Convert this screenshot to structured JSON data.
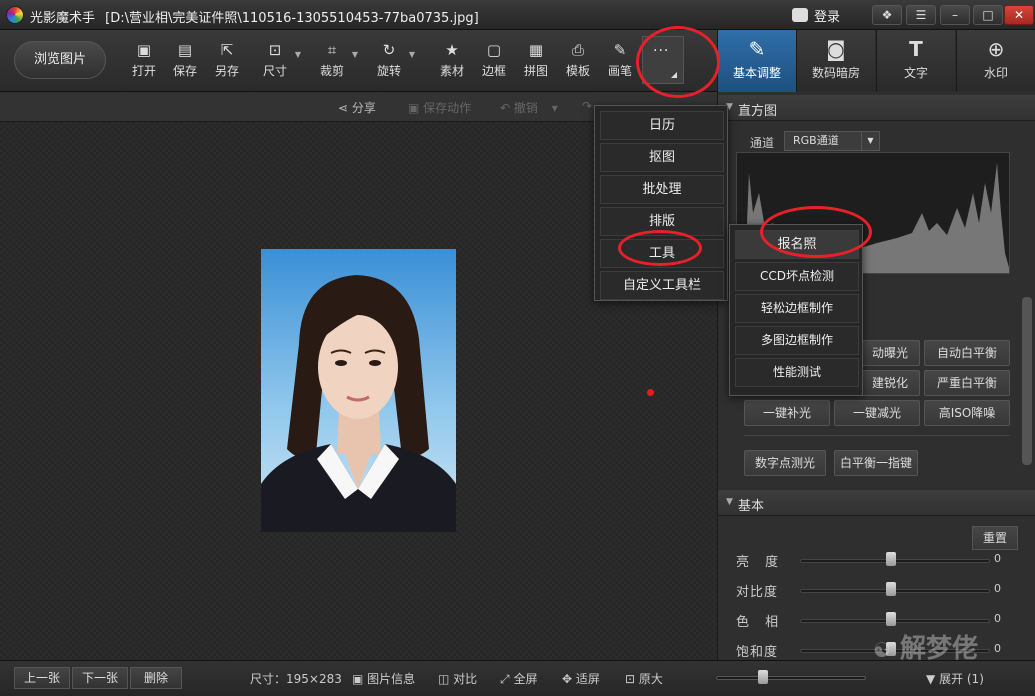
{
  "window": {
    "app_name": "光影魔术手",
    "file_path": "[D:\\营业相\\完美证件照\\110516-1305510453-77ba0735.jpg]",
    "login_label": "登录"
  },
  "toolbar": {
    "browse_label": "浏览图片",
    "tools": [
      {
        "label": "打开",
        "icon": "open-image-icon"
      },
      {
        "label": "保存",
        "icon": "save-icon"
      },
      {
        "label": "另存",
        "icon": "save-as-icon"
      },
      {
        "label": "尺寸",
        "icon": "resize-icon"
      },
      {
        "label": "裁剪",
        "icon": "crop-icon"
      },
      {
        "label": "旋转",
        "icon": "rotate-icon"
      },
      {
        "label": "素材",
        "icon": "material-icon"
      },
      {
        "label": "边框",
        "icon": "frame-icon"
      },
      {
        "label": "拼图",
        "icon": "collage-icon"
      },
      {
        "label": "模板",
        "icon": "template-icon"
      },
      {
        "label": "画笔",
        "icon": "brush-icon"
      }
    ],
    "more_dots": "···"
  },
  "mode_tabs": [
    {
      "label": "基本调整",
      "icon": "adjust-icon",
      "active": true
    },
    {
      "label": "数码暗房",
      "icon": "darkroom-icon",
      "active": false
    },
    {
      "label": "文字",
      "icon": "text-icon",
      "active": false
    },
    {
      "label": "水印",
      "icon": "watermark-icon",
      "active": false
    }
  ],
  "subbar": {
    "share": "分享",
    "save_action": "保存动作",
    "undo": "撤销"
  },
  "more_menu": [
    "日历",
    "抠图",
    "批处理",
    "排版",
    "工具",
    "自定义工具栏"
  ],
  "tools_submenu": [
    "报名照",
    "CCD坏点检测",
    "轻松边框制作",
    "多图边框制作",
    "性能测试"
  ],
  "panel": {
    "histogram_title": "直方图",
    "channel_label": "通道",
    "channel_value": "RGB通道",
    "quick_buttons": [
      "动曝光",
      "自动白平衡",
      "建锐化",
      "严重白平衡",
      "一键补光",
      "一键减光",
      "高ISO降噪",
      "数字点测光",
      "白平衡一指键"
    ],
    "basic_title": "基本",
    "reset_label": "重置",
    "sliders": [
      {
        "label": "亮 度",
        "value": "0"
      },
      {
        "label": "对比度",
        "value": "0"
      },
      {
        "label": "色 相",
        "value": "0"
      },
      {
        "label": "饱和度",
        "value": "0"
      }
    ]
  },
  "statusbar": {
    "prev": "上一张",
    "next": "下一张",
    "delete": "删除",
    "size": "尺寸：195×283",
    "info": "图片信息",
    "compare": "对比",
    "fullscreen": "全屏",
    "fit": "适屏",
    "original": "原大",
    "expand": "展开 (1)"
  },
  "watermark_text": "解梦佬"
}
